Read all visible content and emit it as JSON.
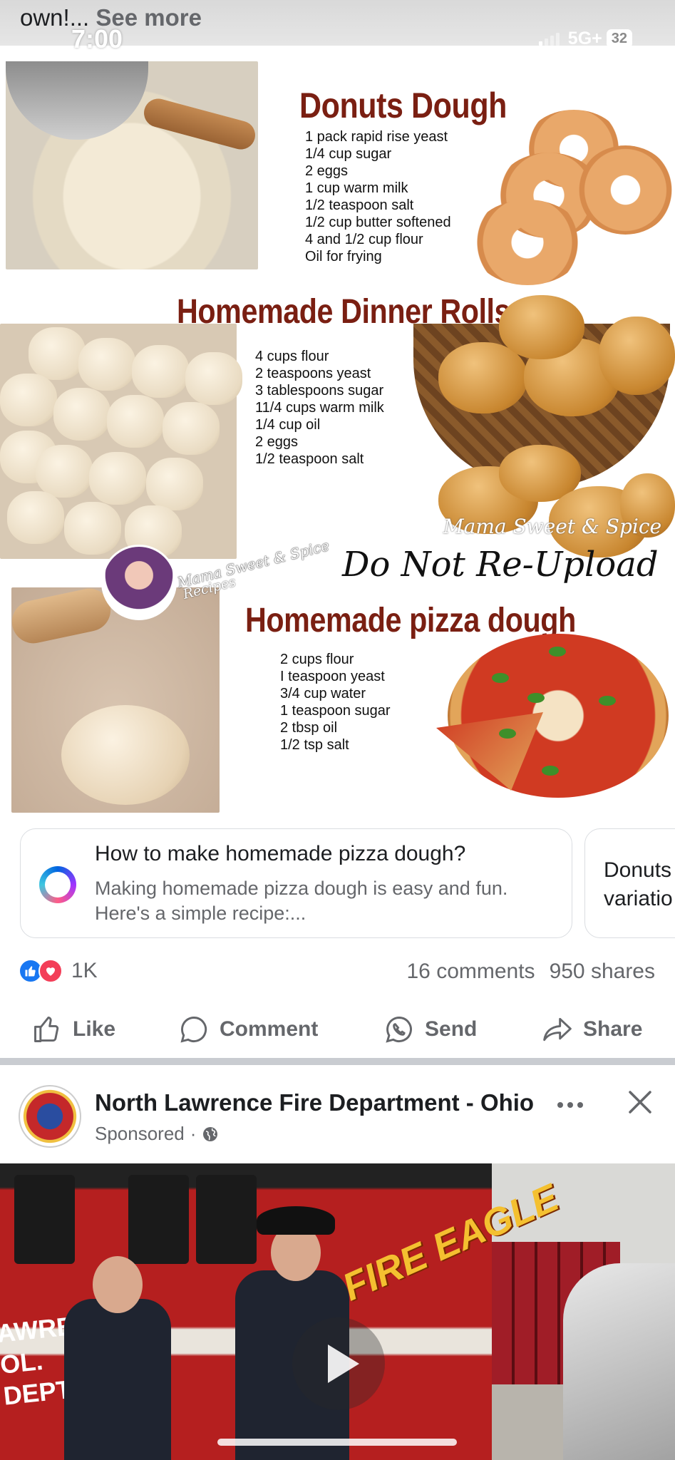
{
  "status_bar": {
    "time": "7:00",
    "network": "5G+",
    "battery": "32"
  },
  "previous_post": {
    "caption_tail": "own!...",
    "see_more": "See more"
  },
  "recipe_image": {
    "donuts": {
      "title": "Donuts Dough",
      "ingredients": [
        "1 pack rapid rise yeast",
        "1/4 cup sugar",
        "2 eggs",
        "1 cup warm milk",
        "1/2 teaspoon salt",
        "1/2 cup butter softened",
        "4 and 1/2 cup flour",
        "Oil for frying"
      ]
    },
    "rolls": {
      "title": "Homemade Dinner Rolls",
      "ingredients": [
        "4 cups flour",
        "2 teaspoons yeast",
        "3 tablespoons sugar",
        "11/4 cups warm milk",
        "1/4 cup oil",
        "2 eggs",
        "1/2 teaspoon salt"
      ]
    },
    "pizza": {
      "title": "Homemade pizza dough",
      "ingredients": [
        "2 cups flour",
        "I teaspoon yeast",
        "3/4 cup water",
        "1 teaspoon sugar",
        "2 tbsp oil",
        "1/2 tsp salt"
      ]
    },
    "watermark_brand": "Mama Sweet & Spice",
    "watermark_notice": "Do Not Re-Upload",
    "watermark_badge_line1": "Mama Sweet & Spice",
    "watermark_badge_line2": "Recipes"
  },
  "ai_prompts": [
    {
      "title": "How to make homemade pizza dough?",
      "body": "Making homemade pizza dough is easy and fun. Here's a simple recipe:..."
    },
    {
      "title_line1": "Donuts",
      "title_line2": "variatio"
    }
  ],
  "engagement": {
    "reactions_count": "1K",
    "comments": "16 comments",
    "shares": "950 shares"
  },
  "actions": {
    "like": "Like",
    "comment": "Comment",
    "send": "Send",
    "share": "Share"
  },
  "sponsored_post": {
    "page_name": "North Lawrence Fire Department - Ohio",
    "label": "Sponsored",
    "separator": "·",
    "video_overlay_text": "FIRE EAGLE",
    "truck_text": "AWREN\nOL.\nDEPT"
  },
  "colors": {
    "facebook_blue": "#1877f2",
    "love_red": "#f33e58",
    "recipe_title": "#7a1f12",
    "secondary_text": "#65676b"
  }
}
